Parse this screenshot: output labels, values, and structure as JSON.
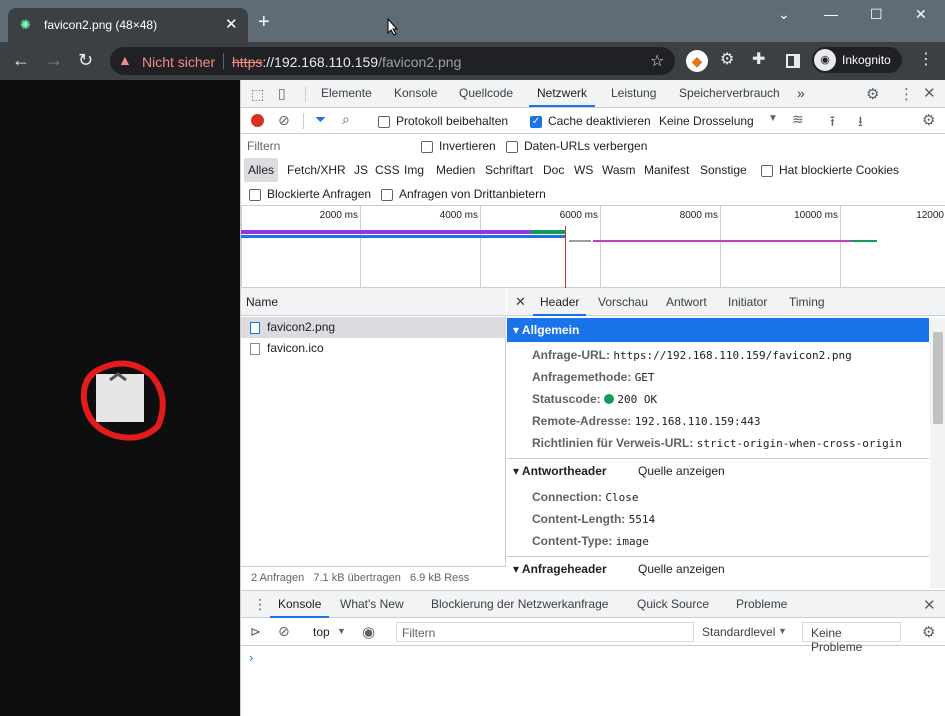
{
  "browser": {
    "tab_title": "favicon2.png (48×48)",
    "tab_close": "✕",
    "new_tab": "+",
    "window_controls": [
      "⌄",
      "—",
      "☐",
      "✕"
    ],
    "security_label": "Nicht sicher",
    "url_scheme": "https",
    "url_host": "://192.168.110.159",
    "url_path": "/favicon2.png",
    "incognito_label": "Inkognito"
  },
  "devtools": {
    "main_tabs": [
      "Elemente",
      "Konsole",
      "Quellcode",
      "Netzwerk",
      "Leistung",
      "Speicherverbrauch"
    ],
    "selected_main_tab": "Netzwerk",
    "more_tabs": "»",
    "network_toolbar": {
      "preserve_log": "Protokoll beibehalten",
      "disable_cache": "Cache deaktivieren",
      "throttling": "Keine Drosselung"
    },
    "filter_row": {
      "placeholder": "Filtern",
      "invert": "Invertieren",
      "hide_data_urls": "Daten-URLs verbergen"
    },
    "type_filters": [
      "Alles",
      "Fetch/XHR",
      "JS",
      "CSS",
      "Img",
      "Medien",
      "Schriftart",
      "Doc",
      "WS",
      "Wasm",
      "Manifest",
      "Sonstige"
    ],
    "blocked_cookies": "Hat blockierte Cookies",
    "blocked_requests": "Blockierte Anfragen",
    "third_party": "Anfragen von Drittanbietern",
    "timeline_ticks": [
      "2000 ms",
      "4000 ms",
      "6000 ms",
      "8000 ms",
      "10000 ms",
      "12000"
    ],
    "request_list": {
      "header": "Name",
      "requests": [
        "favicon2.png",
        "favicon.ico"
      ],
      "status": "2 Anfragen   7.1 kB übertragen   6.9 kB Ress"
    },
    "detail": {
      "tabs": [
        "Header",
        "Vorschau",
        "Antwort",
        "Initiator",
        "Timing"
      ],
      "selected_tab": "Header",
      "general_title": "Allgemein",
      "general": [
        {
          "k": "Anfrage-URL:",
          "v": "https://192.168.110.159/favicon2.png"
        },
        {
          "k": "Anfragemethode:",
          "v": "GET"
        },
        {
          "k": "Statuscode:",
          "v": "200 OK"
        },
        {
          "k": "Remote-Adresse:",
          "v": "192.168.110.159:443"
        },
        {
          "k": "Richtlinien für Verweis-URL:",
          "v": "strict-origin-when-cross-origin"
        }
      ],
      "response_title": "Antwortheader",
      "view_source": "Quelle anzeigen",
      "response": [
        {
          "k": "Connection:",
          "v": "Close"
        },
        {
          "k": "Content-Length:",
          "v": "5514"
        },
        {
          "k": "Content-Type:",
          "v": "image"
        }
      ],
      "request_title": "Anfrageheader",
      "view_source2": "Quelle anzeigen"
    },
    "drawer": {
      "tabs": [
        "Konsole",
        "What's New",
        "Blockierung der Netzwerkanfrage",
        "Quick Source",
        "Probleme"
      ],
      "context": "top",
      "filter_placeholder": "Filtern",
      "level": "Standardlevel",
      "issues": "Keine Probleme"
    }
  }
}
